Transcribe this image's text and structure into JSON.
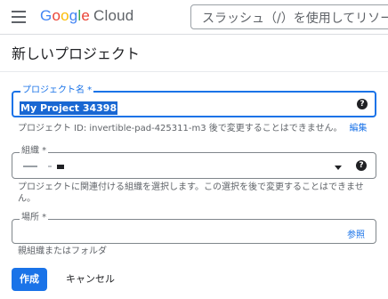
{
  "header": {
    "logo_text": "Google",
    "logo_suffix": "Cloud",
    "search_placeholder": "スラッシュ（/）を使用してリソース、"
  },
  "page": {
    "title": "新しいプロジェクト"
  },
  "form": {
    "project_name": {
      "label": "プロジェクト名 *",
      "value": "My Project 34398",
      "hint_prefix": "プロジェクト ID: invertible-pad-425311-m3 後で変更することはできません。",
      "edit_label": "編集"
    },
    "organization": {
      "label": "組織 *",
      "hint_line1": "プロジェクトに関連付ける組織を選択します。この選択を後で変更することはできませ",
      "hint_line2": "ん。"
    },
    "location": {
      "label": "場所 *",
      "browse_label": "参照",
      "hint": "親組織またはフォルダ"
    },
    "help_icon_glyph": "?"
  },
  "actions": {
    "create_label": "作成",
    "cancel_label": "キャンセル"
  },
  "colors": {
    "accent": "#1a73e8"
  }
}
